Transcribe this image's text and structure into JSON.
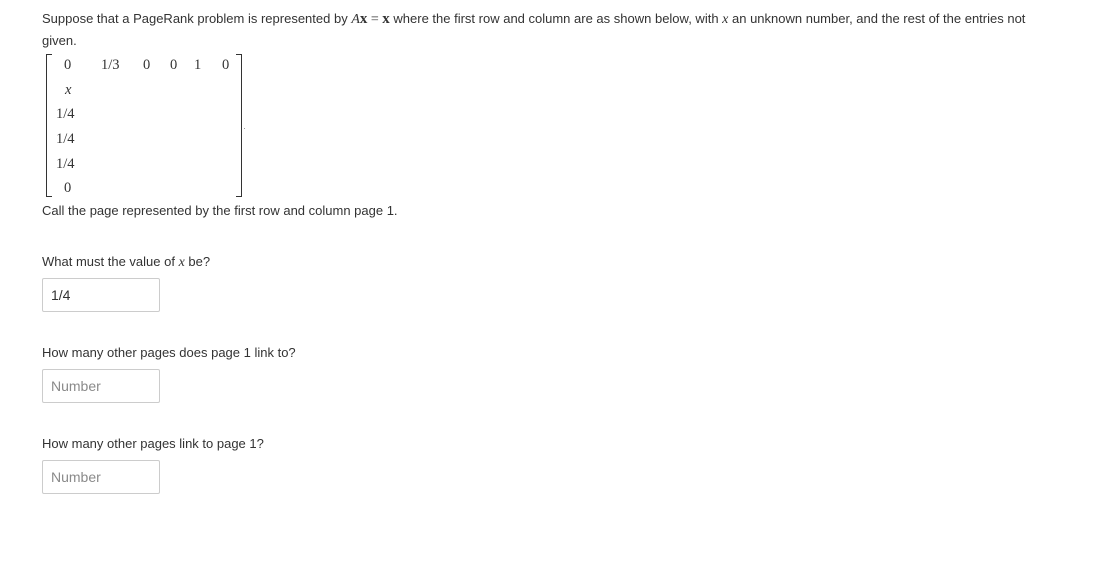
{
  "prompt": {
    "part1": "Suppose that a PageRank problem is represented by ",
    "eq_A": "A",
    "eq_x1": "x",
    "eq_eq": " = ",
    "eq_x2": "x",
    "part2": " where the first row and column are as shown below, with ",
    "var": "x",
    "part3": " an unknown number, and the rest of the entries not given."
  },
  "matrix": {
    "first_row": [
      "0",
      "1/3",
      "0",
      "0",
      "1",
      "0"
    ],
    "first_column": [
      "0",
      "x",
      "1/4",
      "1/4",
      "1/4",
      "0"
    ]
  },
  "note": "Call the page represented by the first row and column page 1.",
  "questions": [
    {
      "pre": "What must the value of ",
      "var": "x",
      "post": " be?",
      "value": "1/4",
      "placeholder": "Number"
    },
    {
      "text": "How many other pages does page 1 link to?",
      "value": "",
      "placeholder": "Number"
    },
    {
      "text": "How many other pages link to page 1?",
      "value": "",
      "placeholder": "Number"
    }
  ]
}
